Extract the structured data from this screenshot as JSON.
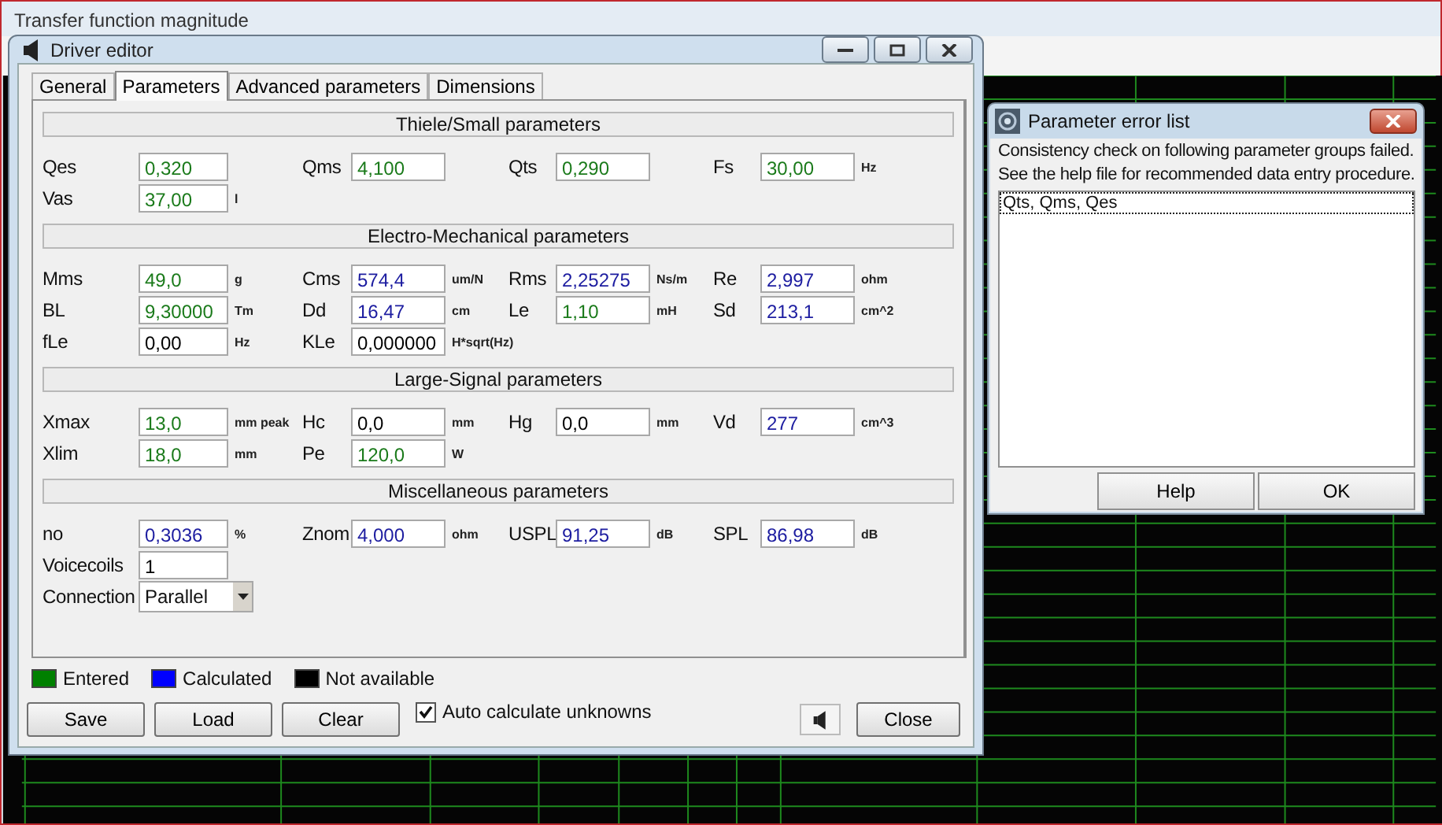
{
  "background_window": {
    "title": "Transfer function magnitude"
  },
  "driver_editor": {
    "title": "Driver editor",
    "tabs": [
      {
        "label": "General",
        "selected": false
      },
      {
        "label": "Parameters",
        "selected": true
      },
      {
        "label": "Advanced parameters",
        "selected": false
      },
      {
        "label": "Dimensions",
        "selected": false
      }
    ],
    "sections": [
      {
        "title": "Thiele/Small parameters",
        "rows": [
          [
            {
              "kind": "field",
              "label": "Qes",
              "value": "0,320",
              "color": "#1a7a1a"
            },
            {
              "kind": "field",
              "label": "Qms",
              "value": "4,100",
              "color": "#1a7a1a"
            },
            {
              "kind": "field",
              "label": "Qts",
              "value": "0,290",
              "color": "#1a7a1a"
            },
            {
              "kind": "field",
              "label": "Fs",
              "value": "30,00",
              "unit": "Hz",
              "color": "#1a7a1a"
            }
          ],
          [
            {
              "kind": "field",
              "label": "Vas",
              "value": "37,00",
              "unit": "l",
              "color": "#1a7a1a"
            }
          ]
        ]
      },
      {
        "title": "Electro-Mechanical parameters",
        "rows": [
          [
            {
              "kind": "field",
              "label": "Mms",
              "value": "49,0",
              "unit": "g",
              "color": "#1a7a1a"
            },
            {
              "kind": "field",
              "label": "Cms",
              "value": "574,4",
              "unit": "um/N",
              "color": "#1c1ca0"
            },
            {
              "kind": "field",
              "label": "Rms",
              "value": "2,25275",
              "unit": "Ns/m",
              "color": "#1c1ca0"
            },
            {
              "kind": "field",
              "label": "Re",
              "value": "2,997",
              "unit": "ohm",
              "color": "#1c1ca0"
            }
          ],
          [
            {
              "kind": "field",
              "label": "BL",
              "value": "9,30000",
              "unit": "Tm",
              "color": "#1a7a1a"
            },
            {
              "kind": "field",
              "label": "Dd",
              "value": "16,47",
              "unit": "cm",
              "color": "#1c1ca0"
            },
            {
              "kind": "field",
              "label": "Le",
              "value": "1,10",
              "unit": "mH",
              "color": "#1a7a1a"
            },
            {
              "kind": "field",
              "label": "Sd",
              "value": "213,1",
              "unit": "cm^2",
              "color": "#1c1ca0"
            }
          ],
          [
            {
              "kind": "field",
              "label": "fLe",
              "value": "0,00",
              "unit": "Hz",
              "color": "#000000"
            },
            {
              "kind": "field",
              "label": "KLe",
              "value": "0,000000",
              "unit": "H*sqrt(Hz)",
              "color": "#000000"
            }
          ]
        ]
      },
      {
        "title": "Large-Signal parameters",
        "rows": [
          [
            {
              "kind": "field",
              "label": "Xmax",
              "value": "13,0",
              "unit": "mm peak",
              "color": "#1a7a1a"
            },
            {
              "kind": "field",
              "label": "Hc",
              "value": "0,0",
              "unit": "mm",
              "color": "#000000"
            },
            {
              "kind": "field",
              "label": "Hg",
              "value": "0,0",
              "unit": "mm",
              "color": "#000000"
            },
            {
              "kind": "field",
              "label": "Vd",
              "value": "277",
              "unit": "cm^3",
              "color": "#1c1ca0"
            }
          ],
          [
            {
              "kind": "field",
              "label": "Xlim",
              "value": "18,0",
              "unit": "mm",
              "color": "#1a7a1a"
            },
            {
              "kind": "field",
              "label": "Pe",
              "value": "120,0",
              "unit": "W",
              "color": "#1a7a1a"
            }
          ]
        ]
      },
      {
        "title": "Miscellaneous parameters",
        "rows": [
          [
            {
              "kind": "field",
              "label": "no",
              "value": "0,3036",
              "unit": "%",
              "color": "#1c1ca0"
            },
            {
              "kind": "field",
              "label": "Znom",
              "value": "4,000",
              "unit": "ohm",
              "color": "#1c1ca0"
            },
            {
              "kind": "field",
              "label": "USPL",
              "value": "91,25",
              "unit": "dB",
              "color": "#1c1ca0"
            },
            {
              "kind": "field",
              "label": "SPL",
              "value": "86,98",
              "unit": "dB",
              "color": "#1c1ca0"
            }
          ],
          [
            {
              "kind": "field",
              "label": "Voicecoils",
              "value": "1",
              "color": "#000000"
            }
          ],
          [
            {
              "kind": "dropdown",
              "label": "Connection",
              "value": "Parallel"
            }
          ]
        ]
      }
    ],
    "legend": [
      {
        "label": "Entered",
        "color": "#008000"
      },
      {
        "label": "Calculated",
        "color": "#0000ff"
      },
      {
        "label": "Not available",
        "color": "#000000"
      }
    ],
    "buttons": [
      "Save",
      "Load",
      "Clear"
    ],
    "auto_calculate": {
      "label": "Auto calculate unknowns",
      "checked": true
    },
    "close_button": "Close"
  },
  "error_dialog": {
    "title": "Parameter error list",
    "message": [
      "Consistency check on following parameter groups failed.",
      "See the help file for recommended data entry procedure."
    ],
    "items": [
      {
        "text": "Qts, Qms, Qes",
        "selected": true
      }
    ],
    "buttons": [
      "Help",
      "OK"
    ]
  }
}
